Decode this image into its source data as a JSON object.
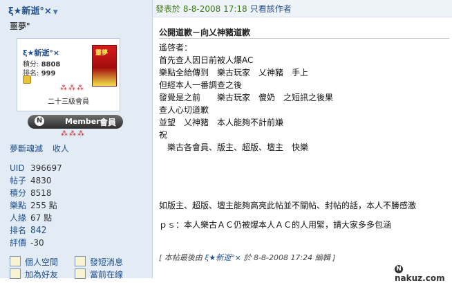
{
  "left": {
    "username": "ξ★新逝°×",
    "user_title": "噩夢\"",
    "card": {
      "name": "ξ★新逝°×",
      "points_label": "積分:",
      "points_value": "8808",
      "rank_label": "排名:",
      "rank_value": "999",
      "avatar_text": "靈夢",
      "level": "二十三級會員",
      "stars": "⁂⁂⁂"
    },
    "member_badge": {
      "text": "Member",
      "cn": "會員"
    },
    "stars2": "⁂⁂⁂",
    "links": [
      "夢斷魂滅",
      "收人"
    ],
    "stats": [
      {
        "k": "UID",
        "v": "396697"
      },
      {
        "k": "帖子",
        "v": "4830"
      },
      {
        "k": "積分",
        "v": "8518"
      },
      {
        "k": "樂點",
        "v": "255 點"
      },
      {
        "k": "人緣",
        "v": "67 點"
      },
      {
        "k": "排名",
        "v": "842"
      },
      {
        "k": "評價",
        "v": "-30"
      }
    ],
    "actions": [
      "個人空間",
      "發短消息",
      "加為好友",
      "當前在線"
    ]
  },
  "post": {
    "posted_at": "發表於 8-8-2008 17:18",
    "author_only": "只看該作者",
    "title": "公開道歉－向乂神豬道歉",
    "lines": [
      "遙啓者：",
      "首先查人因日前被人爆AC",
      "樂點全給傳到　樂古玩家　乂神豬　手上",
      "但經本人一番調查之後",
      "發覺是之前　　樂古玩家　傻奶　之短訊之後果",
      "查人心切道歉",
      "並望　乂神豬　本人能夠不計前嫌",
      "祝",
      "　樂古各會員、版主、超版、壇主　快樂"
    ],
    "ps1": "如版主、超版、壇主能夠高亮此帖並不關帖、封帖的話，本人不勝感激",
    "ps2": "ｐｓ：本人樂古ＡＣ仍被爆本人ＡＣ的人用緊，請大家多多包涵",
    "edit_prefix": "[ 本帖最後由",
    "edit_user": "ξ★新逝°×",
    "edit_suffix": "於 8-8-2008 17:24 編輯 ]"
  },
  "watermark": "nakuz.com",
  "colors": {
    "link": "#1f4f8a",
    "posted": "#3a7a12",
    "panel_bg": "#e3ecf5"
  }
}
